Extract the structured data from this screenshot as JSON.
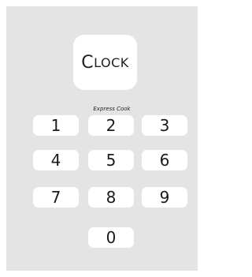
{
  "clock_button": {
    "first": "C",
    "rest": "LOCK"
  },
  "express_cook_label": "Express Cook",
  "keys": [
    "1",
    "2",
    "3",
    "4",
    "5",
    "6",
    "7",
    "8",
    "9",
    "0"
  ],
  "colors": {
    "panel": "#e4e4e4",
    "button": "#ffffff",
    "text": "#1a1a1a"
  }
}
